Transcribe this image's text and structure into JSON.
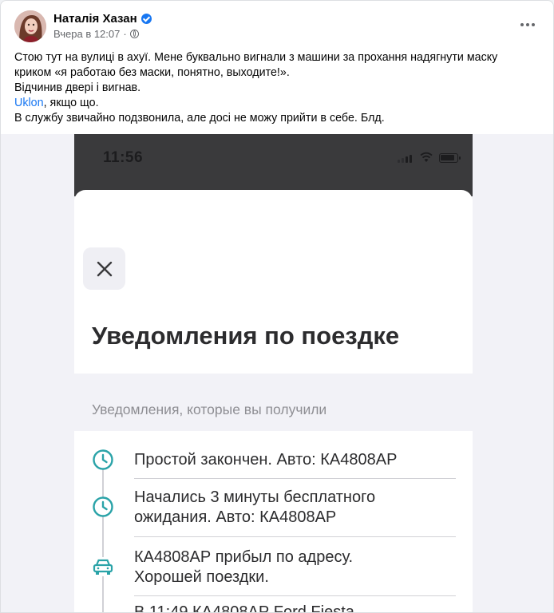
{
  "post": {
    "author": "Наталія Хазан",
    "timestamp": "Вчера в 12:07",
    "meta_separator": "·",
    "lines": [
      "Стою тут на вулиці в ахуї. Мене буквально вигнали з машини за прохання надягнути маску",
      "криком «я работаю без маски, понятно, выходите!».",
      "Відчинив двері і вигнав."
    ],
    "link_text": "Uklon",
    "link_suffix": ", якщо що.",
    "last_line": "В службу звичайно подзвонила, але досі не можу прийти в себе. Блд."
  },
  "screenshot": {
    "status_time": "11:56",
    "title": "Уведомления по поездке",
    "section_label": "Уведомления, которые вы получили",
    "notifications": [
      {
        "icon": "clock-icon",
        "lines": [
          "Простой закончен. Авто: КА4808АР"
        ]
      },
      {
        "icon": "clock-icon",
        "lines": [
          "Начались 3 минуты бесплатного",
          "ожидания. Авто: КА4808АР"
        ]
      },
      {
        "icon": "car-icon",
        "lines": [
          "КА4808АР прибыл по адресу.",
          "Хорошей поездки."
        ]
      },
      {
        "icon": "car-icon",
        "lines": [
          "В 11:49 КА4808АР Ford Fiesta"
        ]
      }
    ]
  },
  "colors": {
    "accent_teal": "#2aa3a8",
    "facebook_blue": "#1877f2"
  }
}
